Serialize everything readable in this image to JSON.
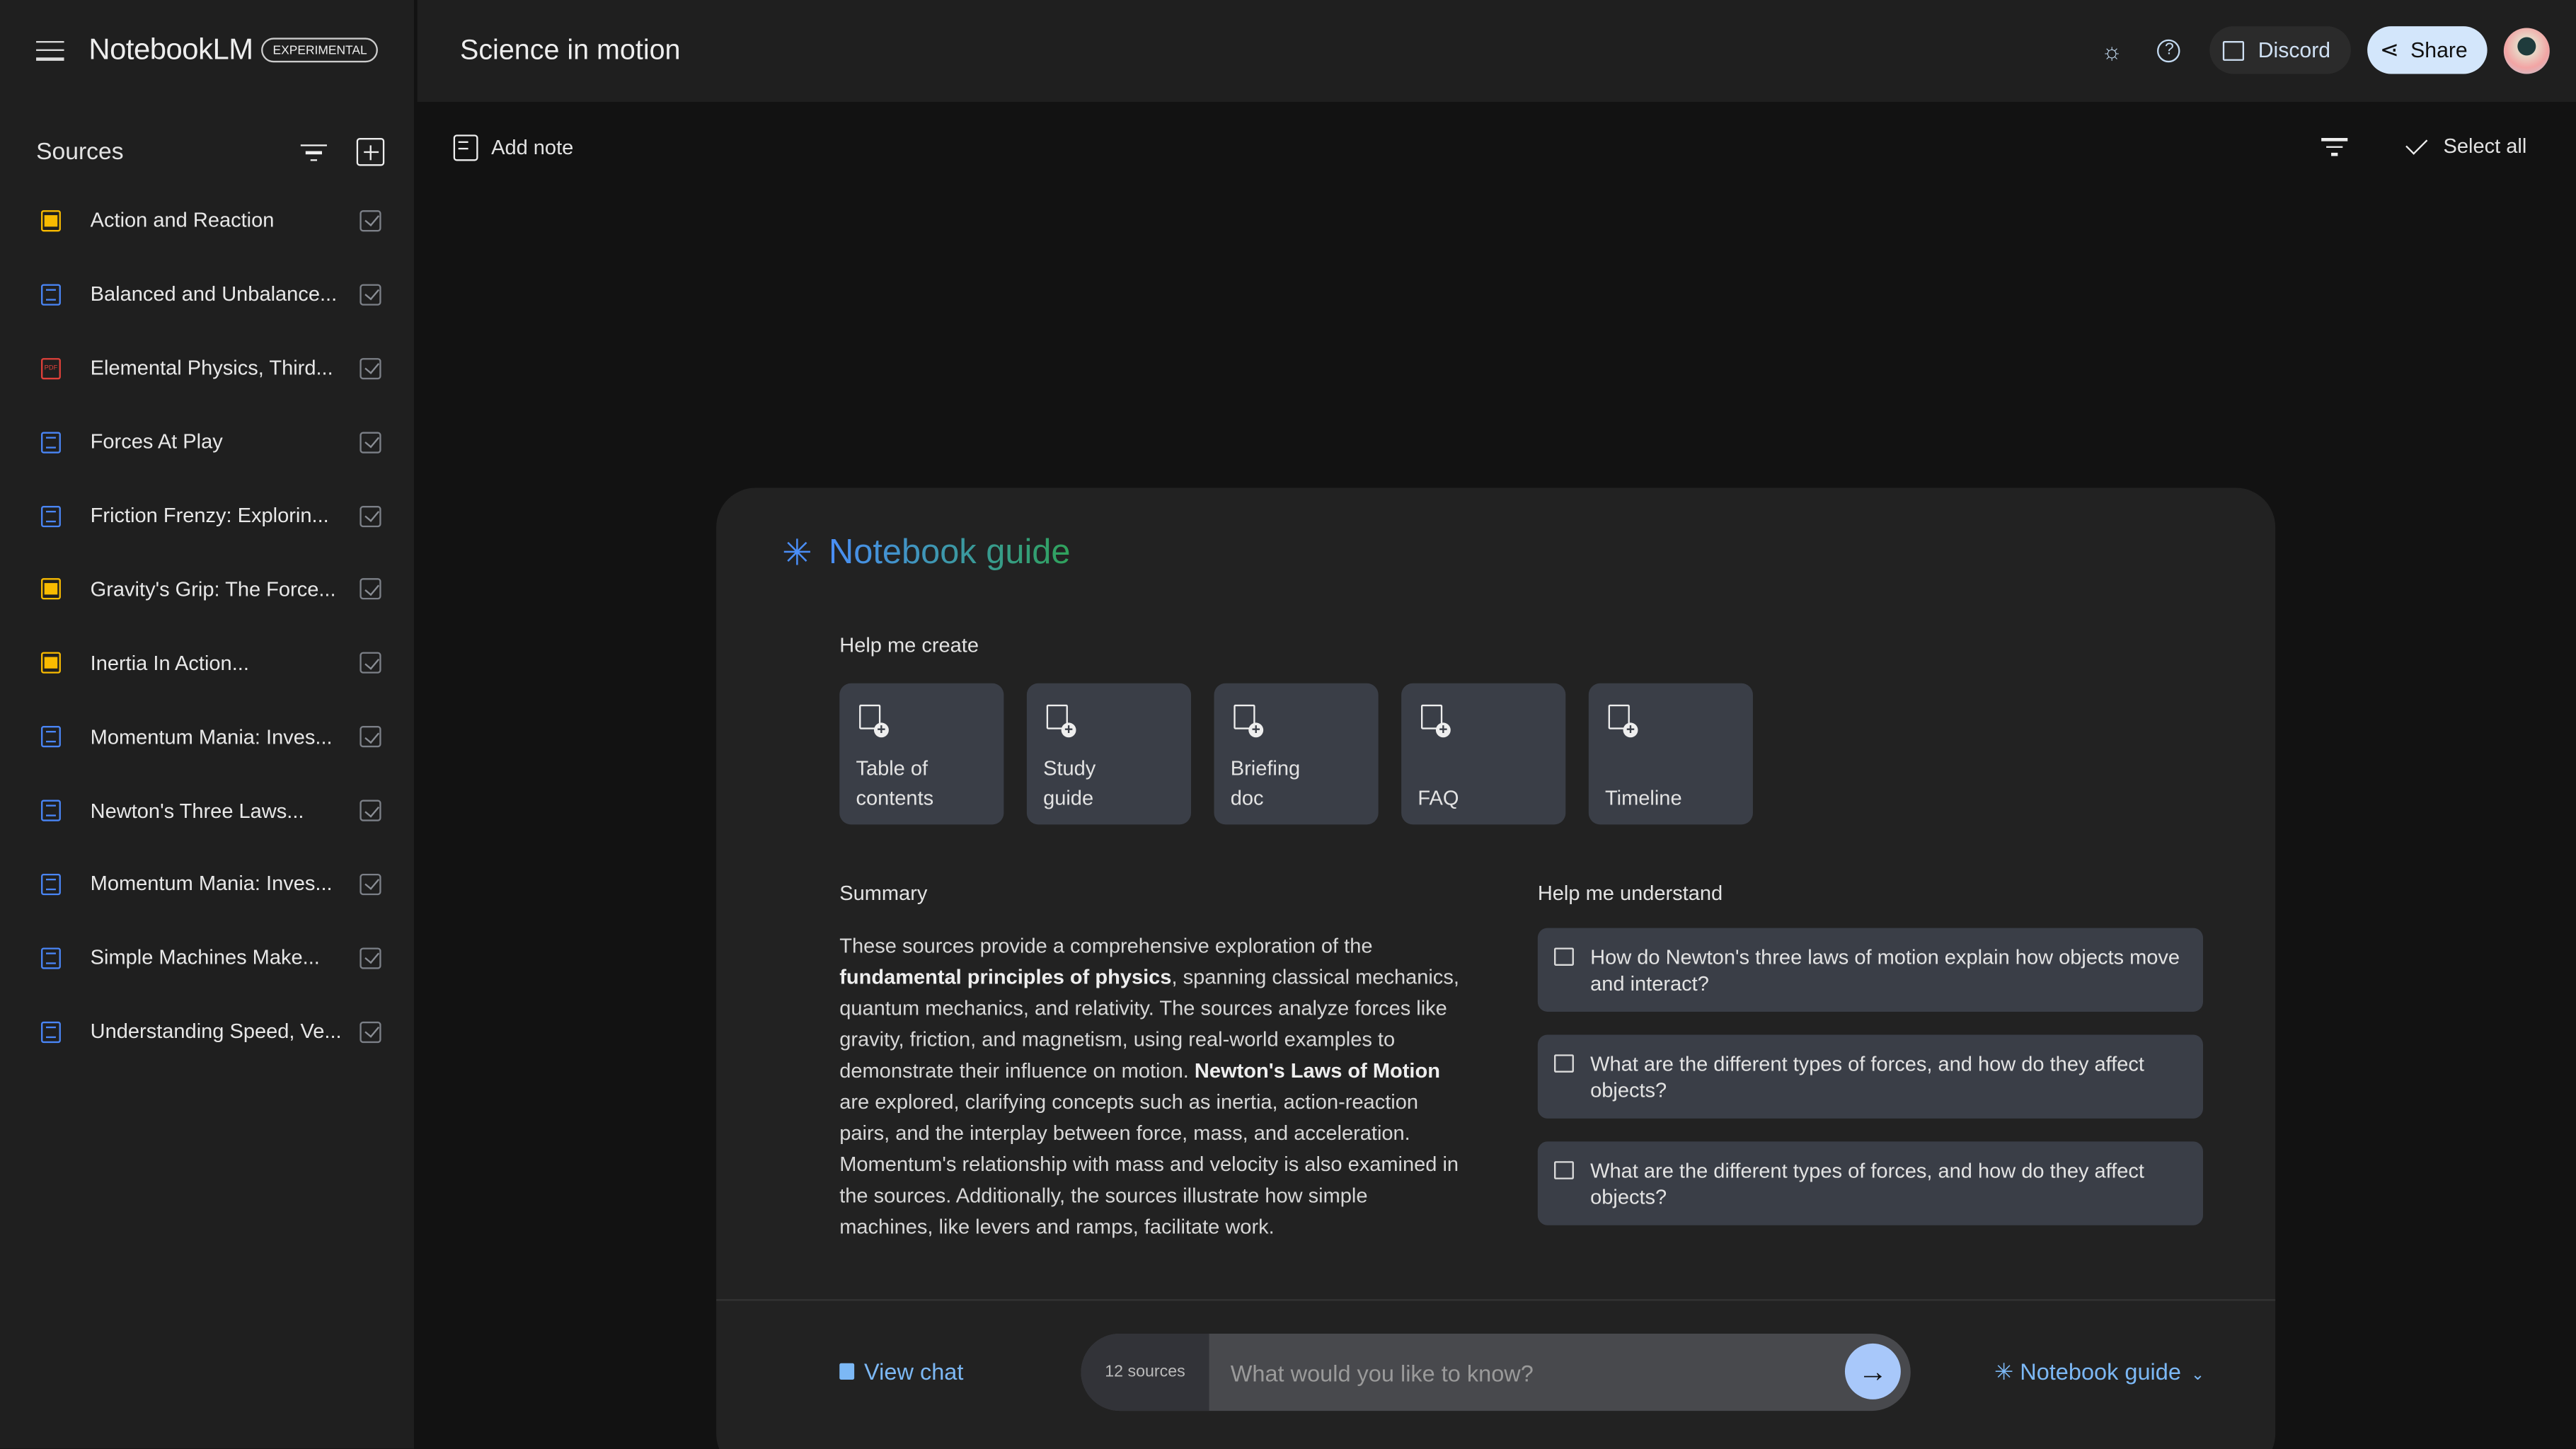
{
  "app": {
    "menu_icon": "hamburger-icon",
    "name": "NotebookLM",
    "badge": "EXPERIMENTAL"
  },
  "sidebar": {
    "title": "Sources",
    "items": [
      {
        "label": "Action and Reaction",
        "type": "slides",
        "checked": true
      },
      {
        "label": "Balanced and Unbalance...",
        "type": "doc",
        "checked": true
      },
      {
        "label": "Elemental Physics, Third...",
        "type": "pdf",
        "checked": true
      },
      {
        "label": "Forces At Play",
        "type": "doc",
        "checked": true
      },
      {
        "label": "Friction Frenzy: Explorin...",
        "type": "doc",
        "checked": true
      },
      {
        "label": "Gravity's Grip: The Force...",
        "type": "slides",
        "checked": true
      },
      {
        "label": "Inertia In Action...",
        "type": "slides",
        "checked": true
      },
      {
        "label": "Momentum Mania: Inves...",
        "type": "doc",
        "checked": true
      },
      {
        "label": "Newton's Three Laws...",
        "type": "doc",
        "checked": true
      },
      {
        "label": "Momentum Mania: Inves...",
        "type": "doc",
        "checked": true
      },
      {
        "label": "Simple Machines Make...",
        "type": "doc",
        "checked": true
      },
      {
        "label": "Understanding Speed, Ve...",
        "type": "doc",
        "checked": true
      }
    ],
    "pdf_label": "PDF"
  },
  "header": {
    "title": "Science in motion",
    "discord": "Discord",
    "share": "Share"
  },
  "notes": {
    "add_note": "Add note",
    "select_all": "Select all"
  },
  "guide": {
    "title": "Notebook guide",
    "help_create": "Help me create",
    "cards": [
      [
        "Table of",
        "contents"
      ],
      [
        "Study",
        "guide"
      ],
      [
        "Briefing",
        "doc"
      ],
      [
        "",
        "FAQ"
      ],
      [
        "",
        "Timeline"
      ]
    ],
    "summary_heading": "Summary",
    "summary": [
      {
        "t": "These sources provide a comprehensive exploration of the ",
        "b": false
      },
      {
        "t": "fundamental principles of physics",
        "b": true
      },
      {
        "t": ", spanning classical mechanics, quantum mechanics, and relativity. The sources analyze forces like gravity, friction, and magnetism, using real-world examples to demonstrate their influence on motion. ",
        "b": false
      },
      {
        "t": "Newton's Laws of Motion",
        "b": true
      },
      {
        "t": " are explored, clarifying concepts such as inertia, action-reaction pairs, and the interplay between force, mass, and acceleration. Momentum's relationship with mass and velocity is also examined in the sources. Additionally, the sources illustrate how simple machines, like levers and ramps, facilitate work.",
        "b": false
      }
    ],
    "help_understand": "Help me understand",
    "questions": [
      "How do Newton's three laws of motion explain how objects move and interact?",
      "What are the different types of forces, and how do they affect objects?",
      "What are the different types of forces, and how do they affect objects?"
    ]
  },
  "chat": {
    "view_chat": "View chat",
    "source_count": "12 sources",
    "placeholder": "What would you like to know?",
    "guide_toggle": "Notebook guide"
  },
  "colors": {
    "accent": "#a8c8fa",
    "slides": "#f9bb00",
    "doc": "#4a86f7",
    "pdf": "#e0413a"
  }
}
